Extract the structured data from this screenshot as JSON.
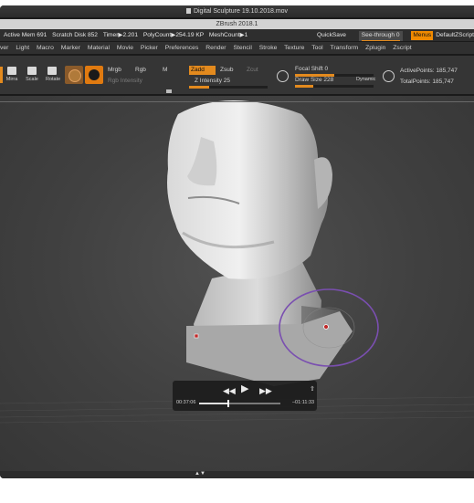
{
  "window": {
    "title": "Digital Sculpture 19.10.2018.mov"
  },
  "app": {
    "title": "ZBrush 2018.1"
  },
  "stats": {
    "active_mem": "Active Mem 691",
    "scratch_disk": "Scratch Disk 852",
    "timer": "Timer▶2.201",
    "polycount": "PolyCount▶254.19 KP",
    "meshcount": "MeshCount▶1",
    "quicksave": "QuickSave",
    "see_through": "See-through",
    "see_through_value": "0",
    "menus": "Menus",
    "default_zscript": "DefaultZScript"
  },
  "menubar": [
    "ver",
    "Light",
    "Macro",
    "Marker",
    "Material",
    "Movie",
    "Picker",
    "Preferences",
    "Render",
    "Stencil",
    "Stroke",
    "Texture",
    "Tool",
    "Transform",
    "Zplugin",
    "Zscript"
  ],
  "shelf": {
    "icons": [
      {
        "label": "Mirra"
      },
      {
        "label": "Scale"
      },
      {
        "label": "Rotate"
      }
    ],
    "mrgb": "Mrgb",
    "rgb": "Rgb",
    "m": "M",
    "rgb_intensity": "Rgb Intensity",
    "zadd": "Zadd",
    "zsub": "Zsub",
    "zcut": "Zcut",
    "z_intensity": "Z Intensity 25",
    "z_intensity_value": 25,
    "focal_shift": "Focal Shift 0",
    "focal_shift_value": 0,
    "draw_size": "Draw Size 228",
    "draw_size_value": 228,
    "dynamic": "Dynamic",
    "active_points": "ActivePoints: 185,747",
    "total_points": "TotalPoints: 185,747"
  },
  "player": {
    "elapsed": "00:37:06",
    "remaining": "–01:11:33",
    "progress": 0.35,
    "rewind_icon": "rewind-icon",
    "play_icon": "play-icon",
    "forward_icon": "fast-forward-icon",
    "share_icon": "share-icon"
  },
  "colors": {
    "accent": "#e38a1e",
    "brush_ring": "#7a4fb0"
  }
}
